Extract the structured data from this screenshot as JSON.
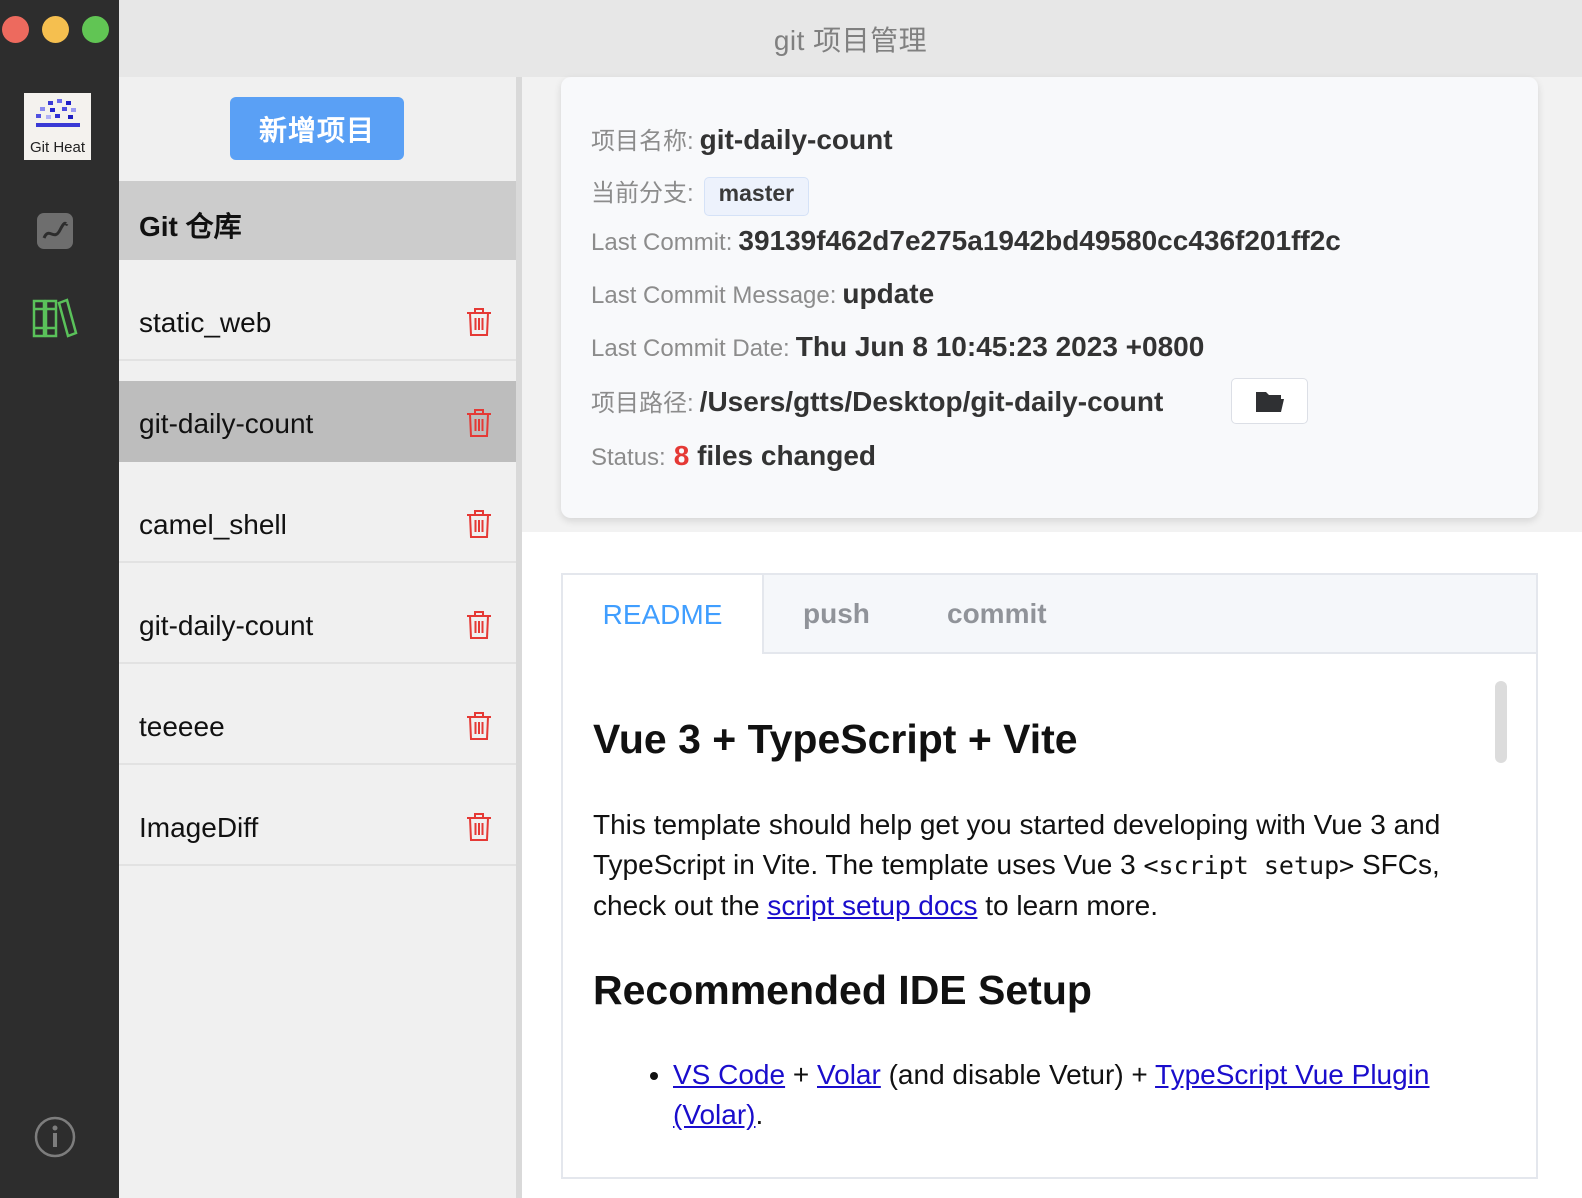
{
  "window": {
    "title": "git 项目管理"
  },
  "rail": {
    "logo_label": "Git Heat"
  },
  "sidebar": {
    "add_button": "新增项目",
    "header": "Git 仓库",
    "projects": [
      {
        "name": "static_web"
      },
      {
        "name": "git-daily-count",
        "selected": true
      },
      {
        "name": "camel_shell"
      },
      {
        "name": "git-daily-count"
      },
      {
        "name": "teeeee"
      },
      {
        "name": "ImageDiff"
      }
    ]
  },
  "info": {
    "name_label": "项目名称:",
    "name_value": "git-daily-count",
    "branch_label": "当前分支:",
    "branch_value": "master",
    "commit_label": "Last Commit:",
    "commit_value": "39139f462d7e275a1942bd49580cc436f201ff2c",
    "message_label": "Last Commit Message:",
    "message_value": "update",
    "date_label": "Last Commit Date:",
    "date_value": "Thu Jun 8 10:45:23 2023 +0800",
    "path_label": "项目路径:",
    "path_value": "/Users/gtts/Desktop/git-daily-count",
    "status_label": "Status:",
    "status_count": "8",
    "status_text": " files changed"
  },
  "tabs": [
    {
      "label": "README",
      "active": true
    },
    {
      "label": "push"
    },
    {
      "label": "commit"
    }
  ],
  "readme": {
    "h1": "Vue 3 + TypeScript + Vite",
    "p1_a": "This template should help get you started developing with Vue 3 and TypeScript in Vite. The template uses Vue 3 ",
    "p1_code": "<script setup>",
    "p1_b": " SFCs, check out the ",
    "p1_link": "script setup docs",
    "p1_c": " to learn more.",
    "h2": "Recommended IDE Setup",
    "li_link1": "VS Code",
    "li_t1": " + ",
    "li_link2": "Volar",
    "li_t2": " (and disable Vetur) + ",
    "li_link3": "TypeScript Vue Plugin (Volar)",
    "li_t3": "."
  },
  "colors": {
    "accent": "#409eff",
    "button": "#5aa0f5",
    "danger": "#e53935",
    "rail_bg": "#2d2d2d",
    "rail_icon_active": "#5ac25a"
  },
  "icons": [
    "logo-icon",
    "chart-icon",
    "books-icon",
    "info-icon",
    "trash-icon",
    "folder-icon"
  ]
}
